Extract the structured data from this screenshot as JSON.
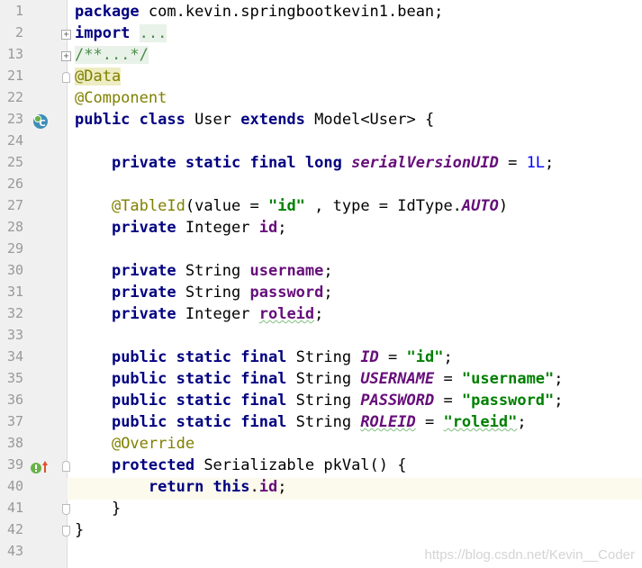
{
  "editor": {
    "lines": [
      {
        "num": "1",
        "tokens": [
          [
            "kw",
            "package"
          ],
          [
            "p",
            " com.kevin.springbootkevin1.bean;"
          ]
        ]
      },
      {
        "num": "2",
        "fold": "plus",
        "tokens": [
          [
            "kw",
            "import"
          ],
          [
            "p",
            " "
          ],
          [
            "fold-text",
            "..."
          ]
        ]
      },
      {
        "num": "13",
        "fold": "plus",
        "tokens": [
          [
            "fold-text",
            "/**...*/"
          ]
        ]
      },
      {
        "num": "21",
        "fold": "start",
        "tokens": [
          [
            "ann hl",
            "@Data"
          ]
        ]
      },
      {
        "num": "22",
        "tokens": [
          [
            "ann",
            "@Component"
          ]
        ]
      },
      {
        "num": "23",
        "icon": "class",
        "tokens": [
          [
            "kw",
            "public class"
          ],
          [
            "p",
            " User "
          ],
          [
            "kw",
            "extends"
          ],
          [
            "p",
            " Model<User> {"
          ]
        ]
      },
      {
        "num": "24",
        "tokens": []
      },
      {
        "num": "25",
        "tokens": [
          [
            "p",
            "    "
          ],
          [
            "kw",
            "private static final long"
          ],
          [
            "p",
            " "
          ],
          [
            "cfield",
            "serialVersionUID"
          ],
          [
            "p",
            " = "
          ],
          [
            "num",
            "1L"
          ],
          [
            "p",
            ";"
          ]
        ]
      },
      {
        "num": "26",
        "tokens": []
      },
      {
        "num": "27",
        "tokens": [
          [
            "p",
            "    "
          ],
          [
            "ann",
            "@TableId"
          ],
          [
            "p",
            "(value = "
          ],
          [
            "str",
            "\"id\""
          ],
          [
            "p",
            " , type = IdType."
          ],
          [
            "cfield",
            "AUTO"
          ],
          [
            "p",
            ")"
          ]
        ]
      },
      {
        "num": "28",
        "tokens": [
          [
            "p",
            "    "
          ],
          [
            "kw",
            "private"
          ],
          [
            "p",
            " Integer "
          ],
          [
            "fieldv",
            "id"
          ],
          [
            "p",
            ";"
          ]
        ]
      },
      {
        "num": "29",
        "tokens": []
      },
      {
        "num": "30",
        "tokens": [
          [
            "p",
            "    "
          ],
          [
            "kw",
            "private"
          ],
          [
            "p",
            " String "
          ],
          [
            "fieldv",
            "username"
          ],
          [
            "p",
            ";"
          ]
        ]
      },
      {
        "num": "31",
        "tokens": [
          [
            "p",
            "    "
          ],
          [
            "kw",
            "private"
          ],
          [
            "p",
            " String "
          ],
          [
            "fieldv",
            "password"
          ],
          [
            "p",
            ";"
          ]
        ]
      },
      {
        "num": "32",
        "tokens": [
          [
            "p",
            "    "
          ],
          [
            "kw",
            "private"
          ],
          [
            "p",
            " Integer "
          ],
          [
            "fieldv squig",
            "roleid"
          ],
          [
            "p",
            ";"
          ]
        ]
      },
      {
        "num": "33",
        "tokens": []
      },
      {
        "num": "34",
        "tokens": [
          [
            "p",
            "    "
          ],
          [
            "kw",
            "public static final"
          ],
          [
            "p",
            " String "
          ],
          [
            "cfield",
            "ID"
          ],
          [
            "p",
            " = "
          ],
          [
            "str",
            "\"id\""
          ],
          [
            "p",
            ";"
          ]
        ]
      },
      {
        "num": "35",
        "tokens": [
          [
            "p",
            "    "
          ],
          [
            "kw",
            "public static final"
          ],
          [
            "p",
            " String "
          ],
          [
            "cfield",
            "USERNAME"
          ],
          [
            "p",
            " = "
          ],
          [
            "str",
            "\"username\""
          ],
          [
            "p",
            ";"
          ]
        ]
      },
      {
        "num": "36",
        "tokens": [
          [
            "p",
            "    "
          ],
          [
            "kw",
            "public static final"
          ],
          [
            "p",
            " String "
          ],
          [
            "cfield",
            "PASSWORD"
          ],
          [
            "p",
            " = "
          ],
          [
            "str",
            "\"password\""
          ],
          [
            "p",
            ";"
          ]
        ]
      },
      {
        "num": "37",
        "tokens": [
          [
            "p",
            "    "
          ],
          [
            "kw",
            "public static final"
          ],
          [
            "p",
            " String "
          ],
          [
            "cfield squig",
            "ROLEID"
          ],
          [
            "p",
            " = "
          ],
          [
            "str squig",
            "\"roleid\""
          ],
          [
            "p",
            ";"
          ]
        ]
      },
      {
        "num": "38",
        "tokens": [
          [
            "p",
            "    "
          ],
          [
            "ann",
            "@Override"
          ]
        ]
      },
      {
        "num": "39",
        "icon": "override",
        "fold": "start",
        "tokens": [
          [
            "p",
            "    "
          ],
          [
            "kw",
            "protected"
          ],
          [
            "p",
            " Serializable pkVal() {"
          ]
        ]
      },
      {
        "num": "40",
        "current": true,
        "tokens": [
          [
            "p",
            "        "
          ],
          [
            "kw",
            "return this"
          ],
          [
            "p",
            "."
          ],
          [
            "fieldv",
            "id"
          ],
          [
            "p",
            ";"
          ]
        ]
      },
      {
        "num": "41",
        "fold": "end",
        "tokens": [
          [
            "p",
            "    }"
          ]
        ]
      },
      {
        "num": "42",
        "fold": "end",
        "tokens": [
          [
            "p",
            "}"
          ]
        ]
      },
      {
        "num": "43",
        "tokens": []
      }
    ],
    "icons": {
      "class": {
        "name": "class-icon",
        "letter": "C",
        "color": "#3d8eb9",
        "ring": "#6ab14a"
      },
      "override": {
        "name": "override-method-icon",
        "color": "#6ab14a",
        "arrow": "#e0502a"
      }
    }
  },
  "watermark": "https://blog.csdn.net/Kevin__Coder"
}
